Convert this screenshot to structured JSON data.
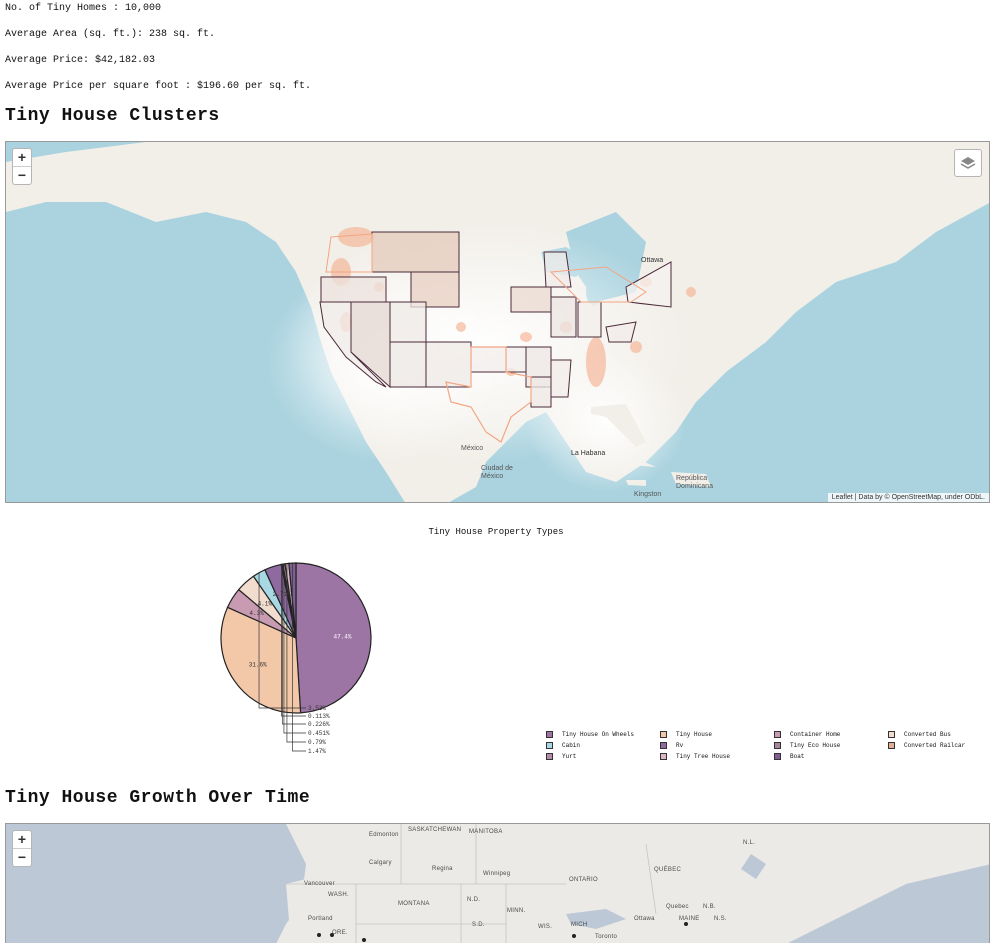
{
  "stats": [
    "No. of Tiny Homes : 10,000",
    "Average Area (sq. ft.): 238 sq. ft.",
    "Average Price: $42,182.03",
    "Average Price per square foot : $196.60 per sq. ft."
  ],
  "section1": {
    "title": "Tiny House Clusters"
  },
  "section2": {
    "title": "Tiny House Growth Over Time"
  },
  "map1": {
    "zoom_in": "+",
    "zoom_out": "−",
    "attribution": "Leaflet | Data by © OpenStreetMap, under ODbL.",
    "labels": [
      "Ottawa",
      "México",
      "Ciudad de México",
      "La Habana",
      "Kingston",
      "República Dominicana"
    ]
  },
  "map2": {
    "zoom_in": "+",
    "zoom_out": "−",
    "labels": [
      "Edmonton",
      "SASKATCHEWAN",
      "MANITOBA",
      "Calgary",
      "Regina",
      "Winnipeg",
      "ONTARIO",
      "QUÉBEC",
      "Vancouver",
      "WASH.",
      "MONTANA",
      "N.D.",
      "MINN.",
      "Portland",
      "ORE.",
      "S.D.",
      "WIS.",
      "MICH",
      "Toronto",
      "Ottawa",
      "Quebec",
      "MAINE",
      "N.B.",
      "N.S.",
      "N.L."
    ]
  },
  "chart_data": {
    "type": "pie",
    "title": "Tiny House Property Types",
    "slices": [
      {
        "label": "Tiny House On Wheels",
        "value": 47.4,
        "color": "#9c75a4"
      },
      {
        "label": "Tiny House",
        "value": 31.6,
        "color": "#f3c8a9"
      },
      {
        "label": "Container Home",
        "value": 4.3,
        "color": "#c89bb2"
      },
      {
        "label": "Converted Bus",
        "value": 4.1,
        "color": "#f1dcce"
      },
      {
        "label": "Cabin",
        "value": 2.7,
        "color": "#a7d8e3"
      },
      {
        "label": "Rv",
        "value": 3.53,
        "color": "#8f6aa0"
      },
      {
        "label": "Tiny Eco House",
        "value": 0.113,
        "color": "#a5879e"
      },
      {
        "label": "Converted Railcar",
        "value": 0.226,
        "color": "#e2ad93"
      },
      {
        "label": "Yurt",
        "value": 0.451,
        "color": "#b58aa6"
      },
      {
        "label": "Tiny Tree House",
        "value": 0.79,
        "color": "#dcb8c5"
      },
      {
        "label": "Boat",
        "value": 1.47,
        "color": "#7d5f94"
      }
    ],
    "pct_labels": [
      "47.4%",
      "31.6%",
      "4.3%",
      "4.1%",
      "3.53%",
      "2.71%",
      "0.113%",
      "0.226%",
      "0.451%",
      "0.79%",
      "1.47%"
    ],
    "legend_order": [
      "Tiny House On Wheels",
      "Tiny House",
      "Container Home",
      "Converted Bus",
      "Cabin",
      "Rv",
      "Tiny Eco House",
      "Converted Railcar",
      "Yurt",
      "Tiny Tree House",
      "Boat"
    ]
  }
}
